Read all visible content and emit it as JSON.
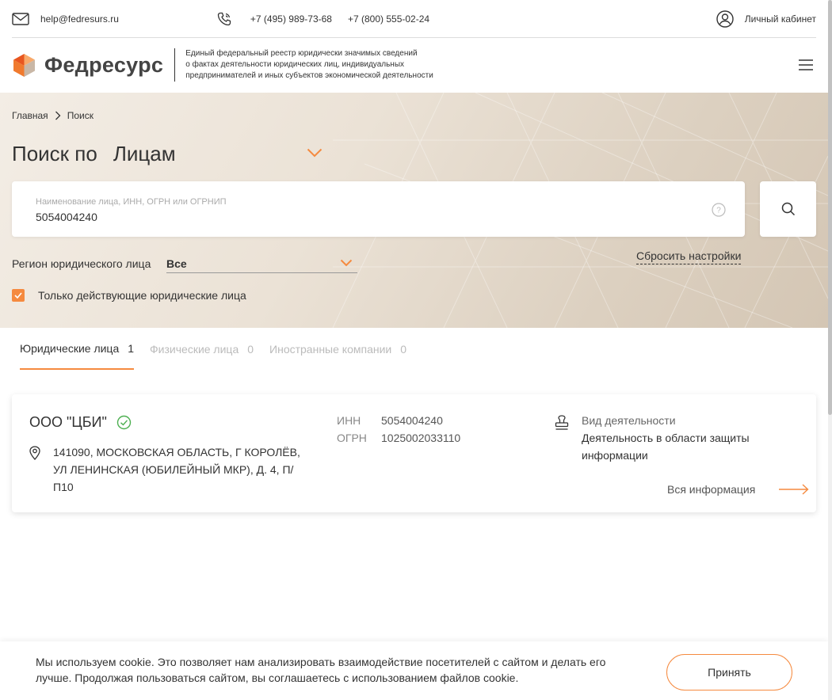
{
  "topbar": {
    "email": "help@fedresurs.ru",
    "phone1": "+7 (495) 989-73-68",
    "phone2": "+7 (800) 555-02-24",
    "cabinet": "Личный кабинет"
  },
  "header": {
    "logo": "Федресурс",
    "tagline_1": "Единый федеральный реестр юридически значимых сведений",
    "tagline_2": "о фактах деятельности юридических лиц, индивидуальных",
    "tagline_3": "предпринимателей и иных субъектов экономической деятельности"
  },
  "breadcrumb": {
    "home": "Главная",
    "current": "Поиск"
  },
  "search": {
    "title_prefix": "Поиск по",
    "mode": "Лицам",
    "field_label": "Наименование лица, ИНН, ОГРН или ОГРНИП",
    "value": "5054004240"
  },
  "filters": {
    "region_label": "Регион юридического лица",
    "region_value": "Все",
    "reset": "Сбросить настройки",
    "active_only": "Только действующие юридические лица"
  },
  "tabs": [
    {
      "label": "Юридические лица",
      "count": "1"
    },
    {
      "label": "Физические лица",
      "count": "0"
    },
    {
      "label": "Иностранные компании",
      "count": "0"
    }
  ],
  "result": {
    "name": "ООО \"ЦБИ\"",
    "address": "141090, МОСКОВСКАЯ ОБЛАСТЬ, Г КОРОЛЁВ, УЛ ЛЕНИНСКАЯ (ЮБИЛЕЙНЫЙ МКР), Д. 4, П/П10",
    "inn_label": "ИНН",
    "inn": "5054004240",
    "ogrn_label": "ОГРН",
    "ogrn": "1025002033110",
    "activity_label": "Вид деятельности",
    "activity": "Деятельность в области защиты информации",
    "more": "Вся информация"
  },
  "cookie": {
    "text": "Мы используем cookie. Это позволяет нам анализировать взаимодействие посетителей с сайтом и делать его лучше. Продолжая пользоваться сайтом, вы соглашаетесь с использованием файлов cookie.",
    "accept": "Принять"
  },
  "colors": {
    "accent": "#f58a3f",
    "status_ok": "#4caf50"
  }
}
